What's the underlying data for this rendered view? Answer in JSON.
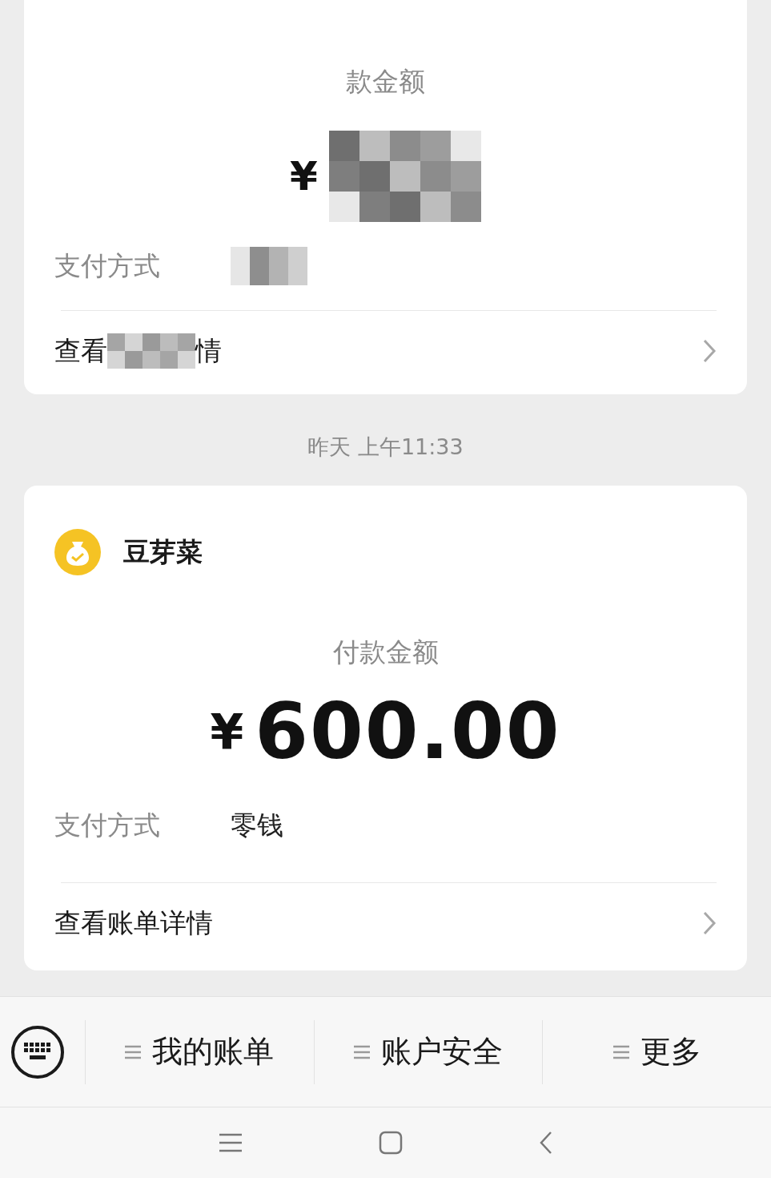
{
  "earlier_payment": {
    "amount_label": "款金额",
    "currency": "¥",
    "method_label": "支付方式",
    "details_link": {
      "prefix": "查看",
      "suffix": "情"
    }
  },
  "timestamp": "昨天 上午11:33",
  "payment": {
    "merchant": "豆芽菜",
    "amount_label": "付款金额",
    "currency": "¥",
    "amount": "600.00",
    "method_label": "支付方式",
    "method": "零钱",
    "details_link": "查看账单详情"
  },
  "menu": [
    "我的账单",
    "账户安全",
    "更多"
  ]
}
